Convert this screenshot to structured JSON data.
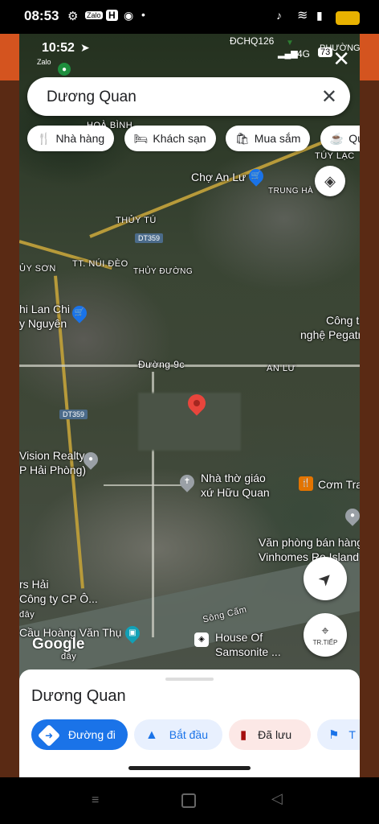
{
  "outer_status": {
    "time": "08:53",
    "apps": [
      "Zalo",
      "H"
    ]
  },
  "inner_status": {
    "time": "10:52",
    "zalo_label": "Zalo",
    "network": "4G",
    "battery": "73",
    "route_label": "ĐCHQ126",
    "corner_label": "PHƯỜNG"
  },
  "search": {
    "query": "Dương Quan"
  },
  "chips": [
    "Nhà hàng",
    "Khách sạn",
    "Mua sắm",
    "Quán"
  ],
  "map_labels": {
    "hoa_binh": "HOÀ BÌNH",
    "tuy_lac": "TÚY LẠC",
    "cho_an_lu": "Chợ An Lư",
    "trung_ha": "TRUNG HÀ",
    "thuy_tu": "THỦY TÚ",
    "dt359_a": "DT359",
    "tt_nui_deo": "TT. NÚI ĐÈO",
    "thuy_son": "ỦY SƠN",
    "thuy_duong": "THỦY ĐƯỜNG",
    "hi_lan_chi": "hi Lan Chi",
    "y_nguyen": "y Nguyên",
    "cong_ty": "Công t",
    "nghe_pegatr": "nghệ Pegatr",
    "duong_9c": "Đường 9c",
    "an_lu": "AN LƯ",
    "dt359_b": "DT359",
    "vision_realty": "Vision Realty",
    "hai_phong": "P Hải Phòng)",
    "nha_tho": "Nhà thờ giáo",
    "xu_huu_quan": "xứ Hữu Quan",
    "com_tra": "Cơm Tra",
    "van_phong": "Văn phòng bán hàng",
    "vinhomes": "Vinhomes Ro  Island",
    "rs_hai": "rs Hải",
    "cong_ty_cp": "Công ty CP Ô...",
    "day_1": "đây",
    "song_cam": "Sông Cấm",
    "cau_hoang": "Cầu Hoàng Văn Thụ",
    "day_2": "đây",
    "house_of": "House Of",
    "samsonite": "Samsonite ..."
  },
  "google_logo": "Google",
  "live_view_label": "TR.TIẾP",
  "sheet": {
    "title": "Dương Quan",
    "actions": [
      "Đường đi",
      "Bắt đầu",
      "Đã lưu",
      "T"
    ]
  },
  "colors": {
    "primary": "#1a73e8",
    "pin": "#e8453c",
    "road": "#b79a3a"
  }
}
